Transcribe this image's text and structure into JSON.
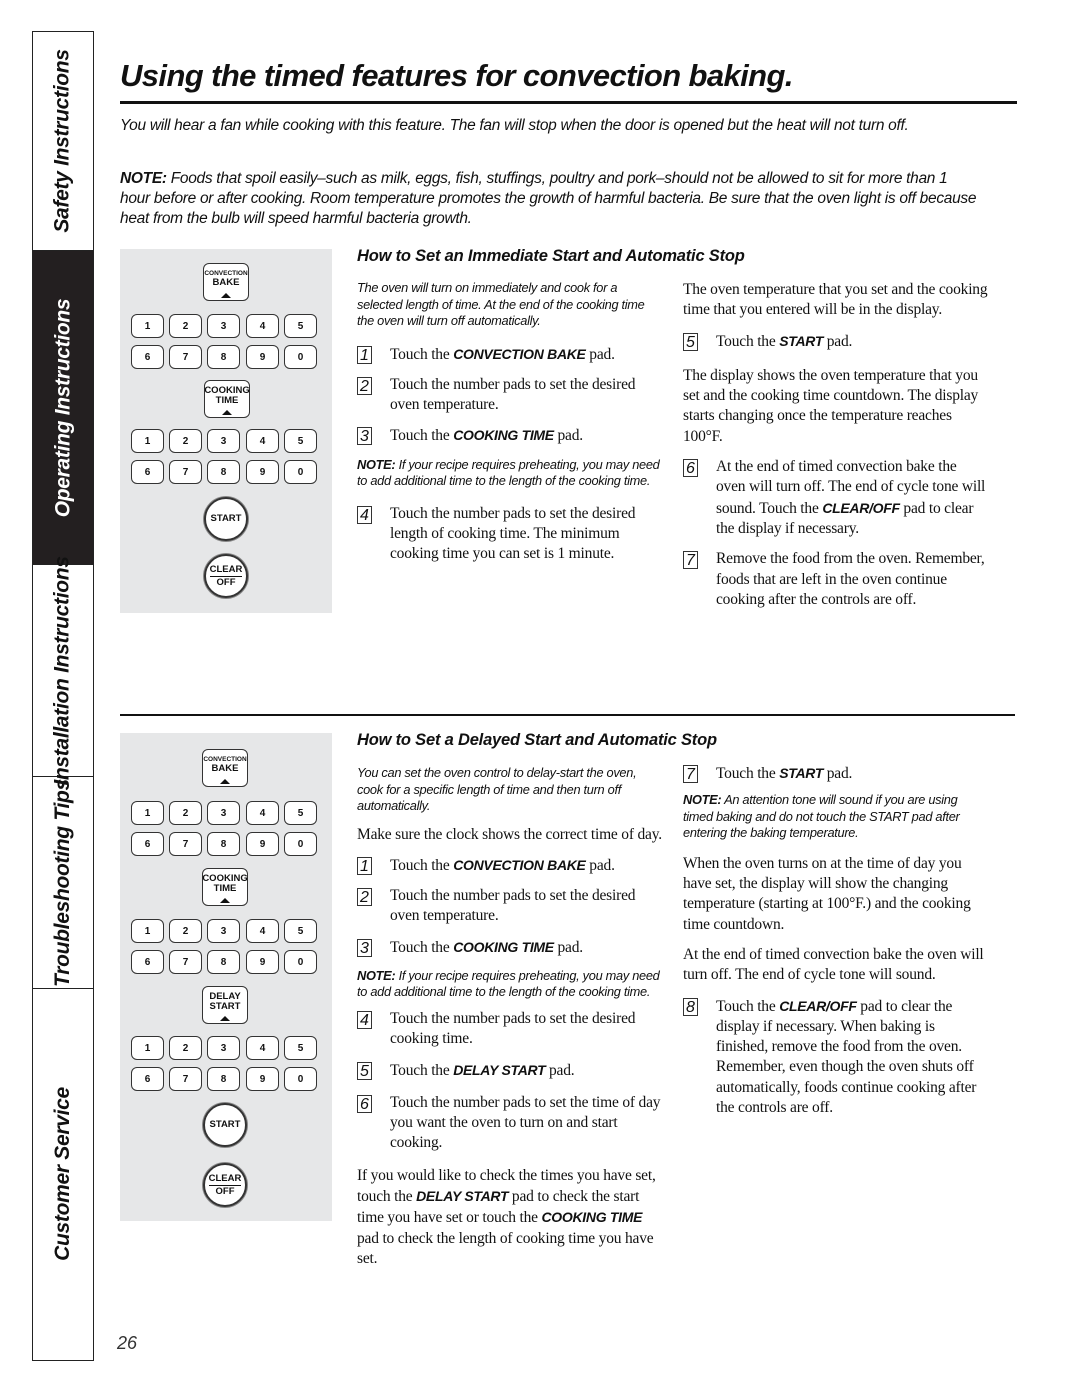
{
  "sidebar": {
    "tabs": [
      {
        "label": "Safety Instructions",
        "active": false
      },
      {
        "label": "Operating Instructions",
        "active": true
      },
      {
        "label": "Installation Instructions",
        "active": false
      },
      {
        "label": "Troubleshooting Tips",
        "active": false
      },
      {
        "label": "Customer Service",
        "active": false
      }
    ]
  },
  "page": {
    "title": "Using the timed features for convection baking.",
    "intro": "You will hear a fan while cooking with this feature. The fan will stop when the door is opened but the heat will not turn off.",
    "note_label": "NOTE:",
    "note_text": " Foods that spoil easily–such as milk, eggs, fish, stuffings, poultry and pork–should not be allowed to sit for more than 1 hour before or after cooking. Room temperature promotes the growth of harmful bacteria. Be sure that the oven light is off because heat from the bulb will speed harmful bacteria growth.",
    "page_number": "26"
  },
  "keypad": {
    "convection_bake_small": "CONVECTION",
    "convection_bake_big": "BAKE",
    "cooking_time_line1": "COOKING",
    "cooking_time_line2": "TIME",
    "delay_start_line1": "DELAY",
    "delay_start_line2": "START",
    "start": "START",
    "clear_line1": "CLEAR",
    "clear_line2": "OFF",
    "numbers": [
      "1",
      "2",
      "3",
      "4",
      "5",
      "6",
      "7",
      "8",
      "9",
      "0"
    ]
  },
  "section1": {
    "heading": "How to Set an Immediate Start and Automatic Stop",
    "lead": "The oven will turn on immediately and cook for a selected length of time. At the end of the cooking time the oven will turn off automatically.",
    "steps": [
      {
        "n": "1",
        "pre": "Touch the ",
        "bold": "CONVECTION BAKE",
        "post": " pad."
      },
      {
        "n": "2",
        "pre": "Touch the number pads to set the desired oven temperature.",
        "bold": "",
        "post": ""
      },
      {
        "n": "3",
        "pre": "Touch the ",
        "bold": "COOKING TIME",
        "post": " pad."
      },
      {
        "n": "4",
        "pre": "Touch the number pads to set the desired length of cooking time. The minimum cooking time you can set is 1 minute.",
        "bold": "",
        "post": ""
      },
      {
        "n": "5",
        "pre": "Touch the ",
        "bold": "START",
        "post": " pad."
      },
      {
        "n": "6",
        "pre": "At the end of timed convection bake the oven will turn off. The end of cycle tone will sound. Touch the ",
        "bold": "CLEAR/OFF",
        "post": " pad to clear the display if necessary."
      },
      {
        "n": "7",
        "pre": "Remove the food from the oven. Remember, foods that are left in the oven continue cooking after the controls are off.",
        "bold": "",
        "post": ""
      }
    ],
    "note_label": "NOTE:",
    "note_text": " If your recipe requires preheating, you may need to add additional time to the length of the cooking time.",
    "display_para": "The oven temperature that you set and the cooking time that you entered will be in the display.",
    "countdown_para": "The display shows the oven temperature that you set and the cooking time countdown. The display starts changing once the temperature reaches 100°F."
  },
  "section2": {
    "heading": "How to Set a Delayed Start and Automatic Stop",
    "lead": "You can set the oven control to delay-start the oven, cook for a specific length of time and then turn off automatically.",
    "clock_para": "Make sure the clock shows the correct time of day.",
    "steps": [
      {
        "n": "1",
        "pre": "Touch the ",
        "bold": "CONVECTION BAKE",
        "post": " pad."
      },
      {
        "n": "2",
        "pre": "Touch the number pads to set the desired oven temperature.",
        "bold": "",
        "post": ""
      },
      {
        "n": "3",
        "pre": "Touch the ",
        "bold": "COOKING TIME",
        "post": " pad."
      },
      {
        "n": "4",
        "pre": "Touch the number pads to set the desired cooking time.",
        "bold": "",
        "post": ""
      },
      {
        "n": "5",
        "pre": "Touch the ",
        "bold": "DELAY START",
        "post": " pad."
      },
      {
        "n": "6",
        "pre": "Touch the number pads to set the time of day you want the oven to turn on and start cooking.",
        "bold": "",
        "post": ""
      },
      {
        "n": "7",
        "pre": "Touch the ",
        "bold": "START",
        "post": " pad."
      },
      {
        "n": "8",
        "pre": "Touch the ",
        "bold": "CLEAR/OFF",
        "post": " pad to clear the display if necessary. When baking is finished, remove the food from the oven. Remember, even though the oven shuts off automatically, foods continue cooking after the controls are off."
      }
    ],
    "note_label": "NOTE:",
    "note_text": " If your recipe requires preheating, you may need to add additional time to the length of the cooking time.",
    "check_para_1": "If you would like to check the times you have set, touch the ",
    "check_bold_1": "DELAY START",
    "check_para_2": " pad to check the start time you have set or touch the ",
    "check_bold_2": "COOKING TIME",
    "check_para_3": " pad to check the length of cooking time you have set.",
    "note2_label": "NOTE:",
    "note2_text": " An attention tone will sound if you are using timed baking and do not touch the START pad after entering the baking temperature.",
    "turns_on_para": "When the oven turns on at the time of day you have set, the display will show the changing temperature (starting at 100°F.) and the cooking time countdown.",
    "end_para": "At the end of timed convection bake the oven will turn off. The end of cycle tone will sound."
  }
}
